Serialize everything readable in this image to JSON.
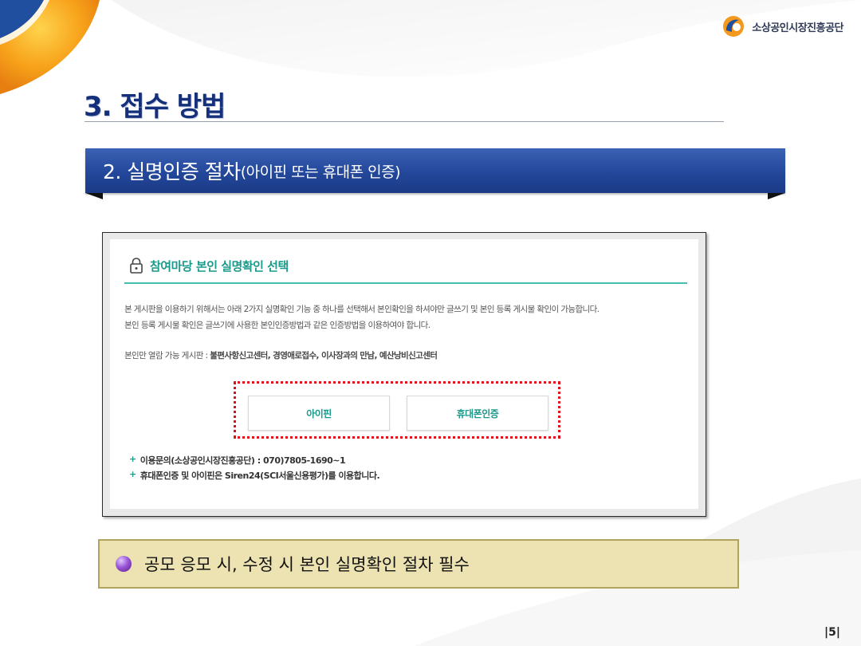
{
  "brand": {
    "name": "소상공인시장진흥공단"
  },
  "page": {
    "title": "3. 접수 방법",
    "number": "|5|"
  },
  "section": {
    "main": "2. 실명인증 절차",
    "sub": "(아이핀 또는 휴대폰 인증)"
  },
  "panel": {
    "title": "참여마당 본인 실명확인 선택",
    "desc_line1": "본 게시판을 이용하기 위해서는 아래 2가지 실명확인 기능 중 하나를 선택해서 본인확인을 하셔야만 글쓰기 및 본인 등록 게시물 확인이 가능합니다.",
    "desc_line2": "본인 등록 게시물 확인은 글쓰기에 사용한 본인인증방법과 같은 인증방법을 이용하여야 합니다.",
    "boards_label": "본인만 열람 가능 게시판 : ",
    "boards_list": "불편사항신고센터, 경영애로접수, 이사장과의 만남, 예산낭비신고센터",
    "buttons": {
      "ipin": "아이핀",
      "phone": "휴대폰인증"
    },
    "note_plus": "+",
    "note1": "이용문의(소상공인시장진흥공단) : 070)7805-1690~1",
    "note2": "휴대폰인증 및 아이핀은 Siren24(SCI서울신용평가)를 이용합니다."
  },
  "callout": {
    "text": "공모 응모 시, 수정 시 본인 실명확인 절차 필수"
  },
  "colors": {
    "title_navy": "#15307a",
    "banner_blue": "#23479a",
    "teal": "#1a9a8a",
    "dotted_red": "#e0101a",
    "callout_bg": "#ede3b2"
  }
}
